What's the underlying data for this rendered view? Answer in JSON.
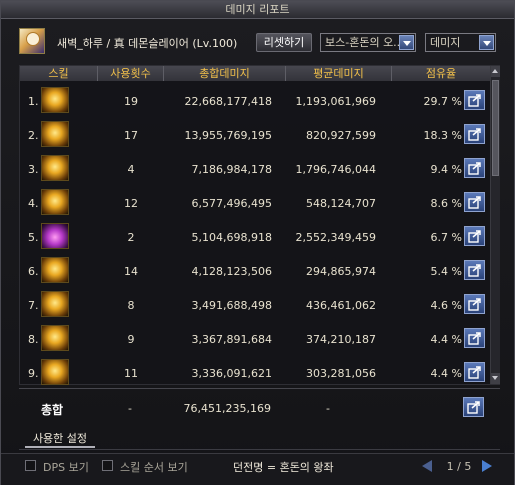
{
  "window": {
    "title": "데미지 리포트"
  },
  "header": {
    "character": "새벽_하루 / 真 데몬슬레이어 (Lv.100)",
    "reset_label": "리셋하기",
    "boss_select": "보스-혼돈의 오...",
    "type_select": "데미지"
  },
  "table": {
    "columns": [
      "스킬",
      "사용횟수",
      "총합데미지",
      "평균데미지",
      "점유율"
    ],
    "rows": [
      {
        "rank": "1.",
        "count": "19",
        "total": "22,668,177,418",
        "avg": "1,193,061,969",
        "share": "29.7 %",
        "icon": "golden-blades-skill-icon"
      },
      {
        "rank": "2.",
        "count": "17",
        "total": "13,955,769,195",
        "avg": "820,927,599",
        "share": "18.3 %",
        "icon": "chain-slash-skill-icon"
      },
      {
        "rank": "3.",
        "count": "4",
        "total": "7,186,984,178",
        "avg": "1,796,746,044",
        "share": "9.4 %",
        "icon": "golden-swirl-skill-icon"
      },
      {
        "rank": "4.",
        "count": "12",
        "total": "6,577,496,495",
        "avg": "548,124,707",
        "share": "8.6 %",
        "icon": "spin-slash-skill-icon"
      },
      {
        "rank": "5.",
        "count": "2",
        "total": "5,104,698,918",
        "avg": "2,552,349,459",
        "share": "6.7 %",
        "icon": "purple-demon-skill-icon"
      },
      {
        "rank": "6.",
        "count": "14",
        "total": "4,128,123,506",
        "avg": "294,865,974",
        "share": "5.4 %",
        "icon": "wave-blade-skill-icon"
      },
      {
        "rank": "7.",
        "count": "8",
        "total": "3,491,688,498",
        "avg": "436,461,062",
        "share": "4.6 %",
        "icon": "cross-chain-skill-icon"
      },
      {
        "rank": "8.",
        "count": "9",
        "total": "3,367,891,684",
        "avg": "374,210,187",
        "share": "4.4 %",
        "icon": "whip-strike-skill-icon"
      },
      {
        "rank": "9.",
        "count": "11",
        "total": "3,336,091,621",
        "avg": "303,281,056",
        "share": "4.4 %",
        "icon": "light-burst-skill-icon"
      }
    ],
    "total": {
      "label": "총합",
      "count": "-",
      "total": "76,451,235,169",
      "avg": "-"
    }
  },
  "tabs": {
    "settings": "사용한 설정"
  },
  "footer": {
    "dps_label": "DPS 보기",
    "skill_order_label": "스킬 순서 보기",
    "dungeon": "던전명 = 혼돈의 왕좌",
    "page": "1 / 5"
  },
  "colors": {
    "header_text": "#f3c14a",
    "share_button": "#3f5c9a",
    "window_bg": "#141417"
  }
}
